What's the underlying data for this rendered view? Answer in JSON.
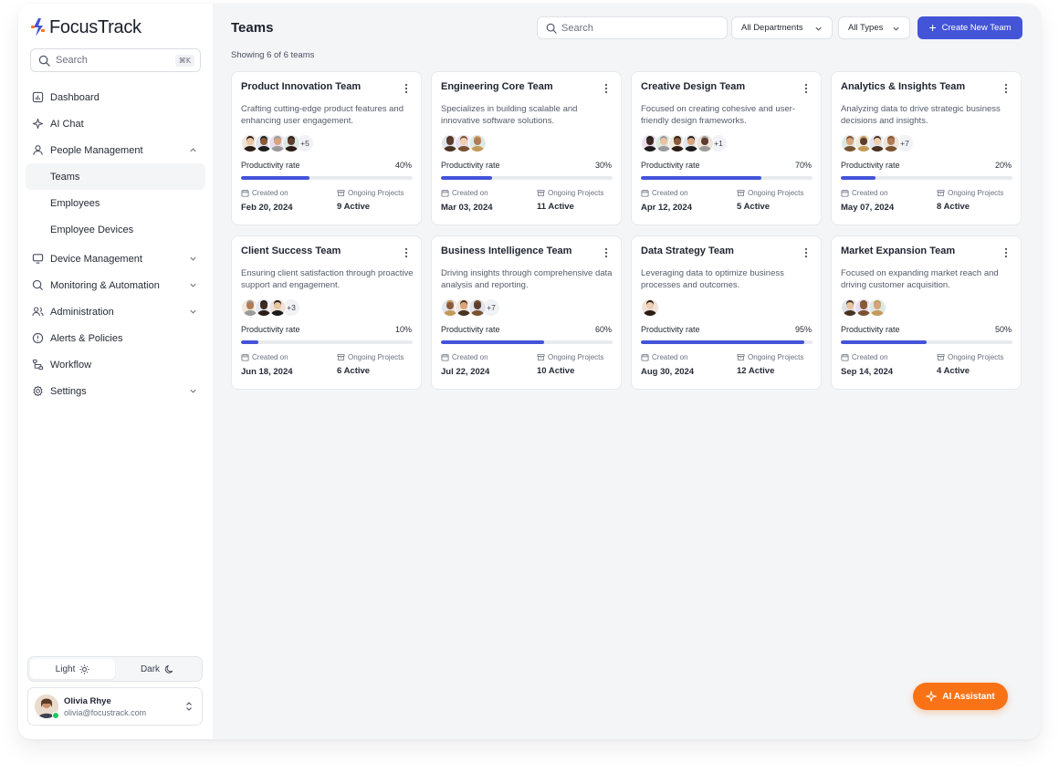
{
  "app": {
    "logo_text": "FocusTrack",
    "accent": "#4354d8",
    "ai_color": "#f97316"
  },
  "sidebar": {
    "search_placeholder": "Search",
    "search_shortcut": "⌘K",
    "items": [
      {
        "label": "Dashboard",
        "icon": "chart-square-icon"
      },
      {
        "label": "AI Chat",
        "icon": "sparkle-icon"
      },
      {
        "label": "People Management",
        "icon": "user-icon",
        "expanded": true
      },
      {
        "label": "Device Management",
        "icon": "monitor-icon"
      },
      {
        "label": "Monitoring & Automation",
        "icon": "search-icon"
      },
      {
        "label": "Administration",
        "icon": "users-icon"
      },
      {
        "label": "Alerts & Policies",
        "icon": "alert-icon"
      },
      {
        "label": "Workflow",
        "icon": "workflow-icon"
      },
      {
        "label": "Settings",
        "icon": "gear-icon"
      }
    ],
    "people_sub": [
      "Teams",
      "Employees",
      "Employee Devices"
    ],
    "active_sub": "Teams",
    "theme": {
      "light": "Light",
      "dark": "Dark",
      "selected": "Light"
    },
    "user": {
      "name": "Olivia Rhye",
      "email": "olivia@focustrack.com",
      "status": "online"
    }
  },
  "main": {
    "title": "Teams",
    "showing": "Showing 6 of 6 teams",
    "search_placeholder": "Search",
    "filter_departments": "All Departments",
    "filter_types": "All Types",
    "create_label": "Create New Team",
    "ai_label": "AI Assistant",
    "labels": {
      "productivity": "Productivity rate",
      "created": "Created on",
      "projects": "Ongoing Projects"
    },
    "teams": [
      {
        "name": "Product Innovation Team",
        "desc": "Crafting cutting-edge product features and enhancing user engagement.",
        "avatars": 4,
        "more": "+5",
        "rate": "40%",
        "created": "Feb 20, 2024",
        "projects": "9 Active"
      },
      {
        "name": "Engineering Core Team",
        "desc": "Specializes in building scalable and innovative software solutions.",
        "avatars": 3,
        "more": "",
        "rate": "30%",
        "created": "Mar 03, 2024",
        "projects": "11 Active"
      },
      {
        "name": "Creative Design Team",
        "desc": "Focused on creating cohesive and user-friendly design frameworks.",
        "avatars": 5,
        "more": "+1",
        "rate": "70%",
        "created": "Apr 12, 2024",
        "projects": "5 Active"
      },
      {
        "name": "Analytics & Insights Team",
        "desc": "Analyzing data to drive strategic business decisions and insights.",
        "avatars": 4,
        "more": "+7",
        "rate": "20%",
        "created": "May 07, 2024",
        "projects": "8 Active"
      },
      {
        "name": "Client Success Team",
        "desc": "Ensuring client satisfaction through proactive support and engagement.",
        "avatars": 3,
        "more": "+3",
        "rate": "10%",
        "created": "Jun 18, 2024",
        "projects": "6 Active"
      },
      {
        "name": "Business Intelligence Team",
        "desc": "Driving insights through comprehensive data analysis and reporting.",
        "avatars": 3,
        "more": "+7",
        "rate": "60%",
        "created": "Jul 22, 2024",
        "projects": "10 Active"
      },
      {
        "name": "Data Strategy Team",
        "desc": "Leveraging data to optimize business processes and outcomes.",
        "avatars": 1,
        "more": "",
        "rate": "95%",
        "created": "Aug 30, 2024",
        "projects": "12 Active"
      },
      {
        "name": "Market Expansion Team",
        "desc": "Focused on expanding market reach and driving customer acquisition.",
        "avatars": 3,
        "more": "",
        "rate": "50%",
        "created": "Sep 14, 2024",
        "projects": "4 Active"
      }
    ]
  }
}
